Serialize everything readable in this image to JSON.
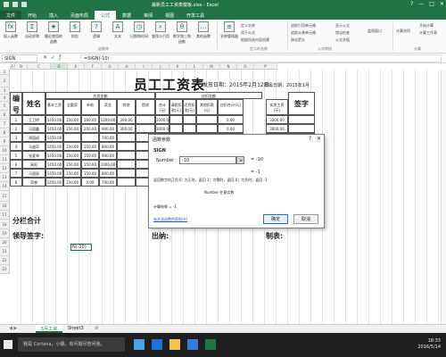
{
  "window": {
    "title": "最新员工工资表模板.xlsx - Excel",
    "controls": [
      "?",
      "—",
      "□",
      "✕"
    ]
  },
  "ribbon_tabs": [
    "文件",
    "开始",
    "插入",
    "页面布局",
    "公式",
    "数据",
    "审阅",
    "视图",
    "开发工具"
  ],
  "ribbon": {
    "buttons": [
      {
        "label": "插入函数",
        "icon": "fx"
      },
      {
        "label": "自动求和",
        "icon": "Σ"
      },
      {
        "label": "最近使用的函数",
        "icon": "★"
      },
      {
        "label": "财务",
        "icon": "$"
      },
      {
        "label": "逻辑",
        "icon": "?"
      },
      {
        "label": "文本",
        "icon": "A"
      },
      {
        "label": "日期和时间",
        "icon": "◷"
      },
      {
        "label": "查找与引用",
        "icon": "⌕"
      },
      {
        "label": "数学和三角函数",
        "icon": "θ"
      },
      {
        "label": "其他函数",
        "icon": "…"
      },
      {
        "label": "名称管理器",
        "icon": "≡"
      }
    ],
    "small_items": [
      "定义名称",
      "用于公式",
      "根据所选内容创建",
      "追踪引用单元格",
      "追踪从属单元格",
      "移去箭头",
      "显示公式",
      "错误检查",
      "公式求值",
      "监视窗口",
      "计算选项",
      "开始计算",
      "计算工作表"
    ],
    "group_labels": [
      "函数库",
      "定义的名称",
      "公式审核",
      "计算"
    ]
  },
  "formula_bar": {
    "name_box": "SIGN",
    "formula": "=SIGN(-10)"
  },
  "columns": [
    "A",
    "B",
    "C",
    "D",
    "E",
    "F",
    "G",
    "H",
    "I",
    "J",
    "K",
    "L",
    "M",
    "N",
    "O",
    "P"
  ],
  "rows": [
    "1",
    "2",
    "3",
    "4",
    "5",
    "6",
    "7",
    "8",
    "9",
    "10",
    "11",
    "12",
    "13",
    "14",
    "15",
    "16",
    "17",
    "18",
    "19",
    "20",
    "21",
    "22",
    "23"
  ],
  "sheet": {
    "title": "员工工资表",
    "issue_date": "发放日期：2015年2月12日",
    "period": "所属日期：2015年1月",
    "header_no": "编号",
    "header_name": "姓名",
    "group_payable": "应发金额",
    "group_deduct": "应扣金额",
    "sub_headers": [
      "基本工资",
      "全勤奖",
      "补助",
      "奖金",
      "其他",
      "提成",
      "合计(元)",
      "请假扣款(元)",
      "迟到扣款(元)",
      "其他扣款(元)",
      "应扣合计(元)",
      "实发工资(元)"
    ],
    "header_sign": "签字",
    "employees": [
      {
        "no": "1",
        "name": "王卫明",
        "values": [
          "1450.00",
          "150.00",
          "200.00",
          "1200.00",
          "300.00",
          "",
          "3300.00",
          "",
          "",
          "",
          "0.00",
          "3300.00"
        ]
      },
      {
        "no": "2",
        "name": "马国鑫",
        "values": [
          "1450.00",
          "150.00",
          "200.00",
          "900.00",
          "300.00",
          "",
          "3000.00",
          "",
          "",
          "",
          "0.00",
          "3000.00"
        ]
      },
      {
        "no": "3",
        "name": "郑国斌",
        "values": [
          "1450.00",
          "",
          "",
          "700.00",
          "",
          "",
          "",
          "",
          "",
          "",
          "",
          ""
        ]
      },
      {
        "no": "4",
        "name": "马盛奇",
        "values": [
          "1450.00",
          "150.00",
          "150.00",
          "800.00",
          "",
          "",
          "",
          "",
          "",
          "",
          "",
          ""
        ]
      },
      {
        "no": "5",
        "name": "张爱琴",
        "values": [
          "1450.00",
          "150.00",
          "150.00",
          "900.00",
          "",
          "",
          "",
          "",
          "",
          "",
          "",
          ""
        ]
      },
      {
        "no": "6",
        "name": "高阳",
        "values": [
          "1450.00",
          "150.00",
          "150.00",
          "1000.00",
          "",
          "",
          "",
          "",
          "",
          "",
          "",
          ""
        ]
      },
      {
        "no": "7",
        "name": "马国丽",
        "values": [
          "1450.00",
          "150.00",
          "150.00",
          "800.00",
          "",
          "",
          "",
          "",
          "",
          "",
          "",
          ""
        ]
      },
      {
        "no": "8",
        "name": "邓睿",
        "values": [
          "1450.00",
          "150.00",
          "0.00",
          "700.00",
          "",
          "",
          "",
          "",
          "",
          "",
          "",
          ""
        ]
      }
    ],
    "subtotal_label": "分栏合计",
    "leader_sign": "领导签字:",
    "cashier": "出纳:",
    "preparer": "制表:",
    "editing_cell": "N(-10)"
  },
  "dialog": {
    "title": "函数参数",
    "help": "?",
    "close": "✕",
    "function_name": "SIGN",
    "arg_label": "Number",
    "arg_value": "-10",
    "arg_eval": "= -10",
    "result_eval": "= -1",
    "description": "返回数字的正负号: 为正时，返回 1；为零时，返回 0；为负时，返回 -1",
    "arg_description": "Number  任意实数",
    "calc_result": "计算结果 =  -1",
    "help_link": "有关该函数的帮助(H)",
    "ok": "确定",
    "cancel": "取消"
  },
  "sheet_tabs": [
    "5月工资",
    "Sheet3"
  ],
  "taskbar": {
    "search": "我是 Cortana，小娜。有问题尽管问我。",
    "time": "18:33",
    "date": "2016/5/14"
  }
}
